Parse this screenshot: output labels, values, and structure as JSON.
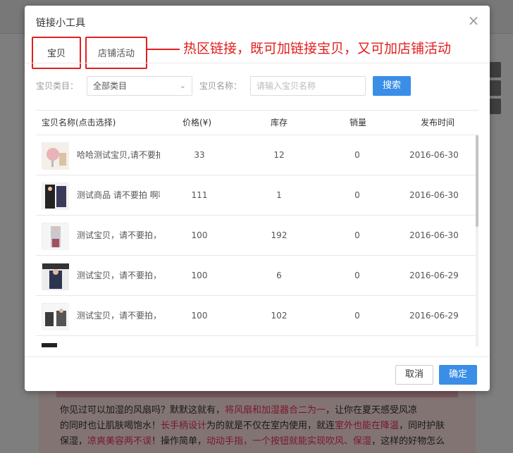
{
  "background": {
    "article_text": {
      "p1a": "你见过可以加湿的风扇吗？默默这就有，",
      "p1b": "将风扇和加湿器合二为一",
      "p1c": "，让你在夏天感受风凉",
      "p2a": "的同时也让肌肤喝饱水！",
      "p2b": "长手柄设计",
      "p2c": "为的就是不仅在室内使用，就连",
      "p2d": "室外也能在降温",
      "p2e": "，同时护肤",
      "p3a": "保湿，",
      "p3b": "凉爽美容两不误",
      "p3c": "！操作简单，",
      "p3d": "动动手指，一个按钮就能实现吹风、保湿",
      "p3e": "，这样的好物怎么"
    }
  },
  "dialog": {
    "title": "链接小工具",
    "close_icon": "close-icon",
    "tabs": [
      {
        "label": "宝贝"
      },
      {
        "label": "店铺活动"
      }
    ],
    "annotation": "热区链接，既可加链接宝贝，又可加店铺活动",
    "filters": {
      "category_label": "宝贝类目：",
      "category_value": "全部类目",
      "name_label": "宝贝名称：",
      "name_placeholder": "请输入宝贝名称",
      "search_label": "搜索"
    },
    "table": {
      "columns": [
        "宝贝名称(点击选择)",
        "价格(¥)",
        "库存",
        "销量",
        "发布时间"
      ],
      "rows": [
        {
          "name": "哈哈测试宝贝,请不要拍",
          "price": "33",
          "stock": "12",
          "sales": "0",
          "date": "2016-06-30"
        },
        {
          "name": "测试商品 请不要拍 啊啊",
          "price": "111",
          "stock": "1",
          "sales": "0",
          "date": "2016-06-30"
        },
        {
          "name": "测试宝贝，请不要拍，",
          "price": "100",
          "stock": "192",
          "sales": "0",
          "date": "2016-06-30"
        },
        {
          "name": "测试宝贝，请不要拍，",
          "price": "100",
          "stock": "6",
          "sales": "0",
          "date": "2016-06-29"
        },
        {
          "name": "测试宝贝，请不要拍，",
          "price": "100",
          "stock": "102",
          "sales": "0",
          "date": "2016-06-29"
        }
      ]
    },
    "footer": {
      "cancel_label": "取消",
      "ok_label": "确定"
    },
    "colors": {
      "accent": "#3a8ee6",
      "annotation": "#e0201e"
    }
  }
}
